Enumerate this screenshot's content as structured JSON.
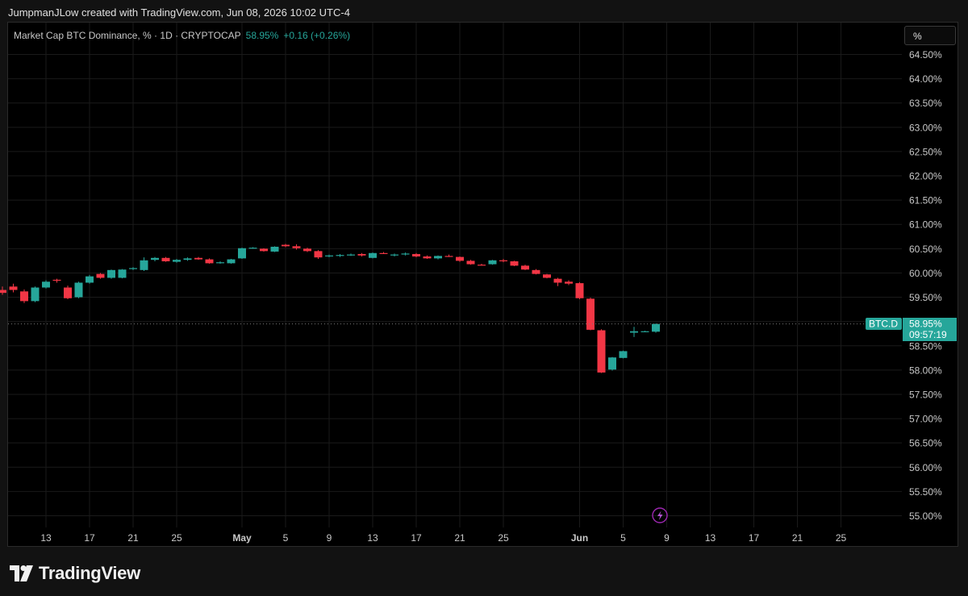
{
  "header": {
    "attribution": "JumpmanJLow created with TradingView.com, Jun 08, 2026 10:02 UTC-4"
  },
  "legend": {
    "symbol": "Market Cap BTC Dominance, % · 1D · CRYPTOCAP",
    "value": "58.95%",
    "change": "+0.16 (+0.26%)"
  },
  "scale_button": {
    "label": "%"
  },
  "price_tag": {
    "symbol": "BTC.D",
    "value": "58.95%",
    "countdown": "09:57:19"
  },
  "footer": {
    "brand": "TradingView"
  },
  "colors": {
    "up": "#26a69a",
    "down": "#f23645",
    "background": "#000000",
    "grid": "#1a1a1a",
    "axis_text": "#c8c8c8"
  },
  "icons": {
    "alert": "lightning-icon",
    "logo": "tradingview-logo-icon"
  },
  "chart_data": {
    "type": "candlestick",
    "title": "Market Cap BTC Dominance, % · 1D · CRYPTOCAP",
    "ylim": [
      54.85,
      64.75
    ],
    "y_ticks": [
      "64.50%",
      "64.00%",
      "63.50%",
      "63.00%",
      "62.50%",
      "62.00%",
      "61.50%",
      "61.00%",
      "60.50%",
      "60.00%",
      "59.50%",
      "59.00%",
      "58.50%",
      "58.00%",
      "57.50%",
      "57.00%",
      "56.50%",
      "56.00%",
      "55.50%",
      "55.00%"
    ],
    "y_tick_values": [
      64.5,
      64.0,
      63.5,
      63.0,
      62.5,
      62.0,
      61.5,
      61.0,
      60.5,
      60.0,
      59.5,
      59.0,
      58.5,
      58.0,
      57.5,
      57.0,
      56.5,
      56.0,
      55.5,
      55.0
    ],
    "x_ticks": [
      {
        "label": "13",
        "date": "2026-04-13",
        "bold": false
      },
      {
        "label": "17",
        "date": "2026-04-17",
        "bold": false
      },
      {
        "label": "21",
        "date": "2026-04-21",
        "bold": false
      },
      {
        "label": "25",
        "date": "2026-04-25",
        "bold": false
      },
      {
        "label": "May",
        "date": "2026-05-01",
        "bold": true
      },
      {
        "label": "5",
        "date": "2026-05-05",
        "bold": false
      },
      {
        "label": "9",
        "date": "2026-05-09",
        "bold": false
      },
      {
        "label": "13",
        "date": "2026-05-13",
        "bold": false
      },
      {
        "label": "17",
        "date": "2026-05-17",
        "bold": false
      },
      {
        "label": "21",
        "date": "2026-05-21",
        "bold": false
      },
      {
        "label": "25",
        "date": "2026-05-25",
        "bold": false
      },
      {
        "label": "Jun",
        "date": "2026-06-01",
        "bold": true
      },
      {
        "label": "5",
        "date": "2026-06-05",
        "bold": false
      },
      {
        "label": "9",
        "date": "2026-06-09",
        "bold": false
      },
      {
        "label": "13",
        "date": "2026-06-13",
        "bold": false
      },
      {
        "label": "17",
        "date": "2026-06-17",
        "bold": false
      },
      {
        "label": "21",
        "date": "2026-06-21",
        "bold": false
      },
      {
        "label": "25",
        "date": "2026-06-25",
        "bold": false
      }
    ],
    "last_value": 58.95,
    "candles": [
      {
        "date": "2026-04-09",
        "open": 59.65,
        "high": 59.72,
        "low": 59.55,
        "close": 59.59
      },
      {
        "date": "2026-04-10",
        "open": 59.72,
        "high": 59.78,
        "low": 59.6,
        "close": 59.65
      },
      {
        "date": "2026-04-11",
        "open": 59.62,
        "high": 59.66,
        "low": 59.38,
        "close": 59.42
      },
      {
        "date": "2026-04-12",
        "open": 59.42,
        "high": 59.72,
        "low": 59.4,
        "close": 59.7
      },
      {
        "date": "2026-04-13",
        "open": 59.7,
        "high": 59.85,
        "low": 59.68,
        "close": 59.82
      },
      {
        "date": "2026-04-14",
        "open": 59.86,
        "high": 59.88,
        "low": 59.8,
        "close": 59.84
      },
      {
        "date": "2026-04-15",
        "open": 59.7,
        "high": 59.74,
        "low": 59.46,
        "close": 59.48
      },
      {
        "date": "2026-04-16",
        "open": 59.5,
        "high": 59.82,
        "low": 59.48,
        "close": 59.8
      },
      {
        "date": "2026-04-17",
        "open": 59.8,
        "high": 59.96,
        "low": 59.78,
        "close": 59.93
      },
      {
        "date": "2026-04-18",
        "open": 59.98,
        "high": 60.0,
        "low": 59.88,
        "close": 59.9
      },
      {
        "date": "2026-04-19",
        "open": 59.9,
        "high": 60.07,
        "low": 59.88,
        "close": 60.06
      },
      {
        "date": "2026-04-20",
        "open": 59.9,
        "high": 60.08,
        "low": 59.89,
        "close": 60.07
      },
      {
        "date": "2026-04-21",
        "open": 60.08,
        "high": 60.12,
        "low": 60.06,
        "close": 60.1
      },
      {
        "date": "2026-04-22",
        "open": 60.06,
        "high": 60.32,
        "low": 60.04,
        "close": 60.26
      },
      {
        "date": "2026-04-23",
        "open": 60.27,
        "high": 60.33,
        "low": 60.24,
        "close": 60.31
      },
      {
        "date": "2026-04-24",
        "open": 60.31,
        "high": 60.33,
        "low": 60.23,
        "close": 60.24
      },
      {
        "date": "2026-04-25",
        "open": 60.23,
        "high": 60.29,
        "low": 60.21,
        "close": 60.27
      },
      {
        "date": "2026-04-26",
        "open": 60.27,
        "high": 60.32,
        "low": 60.25,
        "close": 60.3
      },
      {
        "date": "2026-04-27",
        "open": 60.31,
        "high": 60.33,
        "low": 60.27,
        "close": 60.28
      },
      {
        "date": "2026-04-28",
        "open": 60.28,
        "high": 60.3,
        "low": 60.19,
        "close": 60.2
      },
      {
        "date": "2026-04-29",
        "open": 60.21,
        "high": 60.24,
        "low": 60.19,
        "close": 60.22
      },
      {
        "date": "2026-04-30",
        "open": 60.2,
        "high": 60.29,
        "low": 60.19,
        "close": 60.28
      },
      {
        "date": "2026-05-01",
        "open": 60.3,
        "high": 60.52,
        "low": 60.29,
        "close": 60.51
      },
      {
        "date": "2026-05-02",
        "open": 60.51,
        "high": 60.53,
        "low": 60.5,
        "close": 60.52
      },
      {
        "date": "2026-05-03",
        "open": 60.5,
        "high": 60.51,
        "low": 60.44,
        "close": 60.45
      },
      {
        "date": "2026-05-04",
        "open": 60.44,
        "high": 60.55,
        "low": 60.43,
        "close": 60.54
      },
      {
        "date": "2026-05-05",
        "open": 60.58,
        "high": 60.6,
        "low": 60.53,
        "close": 60.55
      },
      {
        "date": "2026-05-06",
        "open": 60.55,
        "high": 60.59,
        "low": 60.48,
        "close": 60.51
      },
      {
        "date": "2026-05-07",
        "open": 60.5,
        "high": 60.52,
        "low": 60.43,
        "close": 60.45
      },
      {
        "date": "2026-05-08",
        "open": 60.45,
        "high": 60.47,
        "low": 60.29,
        "close": 60.32
      },
      {
        "date": "2026-05-09",
        "open": 60.34,
        "high": 60.38,
        "low": 60.32,
        "close": 60.36
      },
      {
        "date": "2026-05-10",
        "open": 60.35,
        "high": 60.39,
        "low": 60.33,
        "close": 60.37
      },
      {
        "date": "2026-05-11",
        "open": 60.37,
        "high": 60.4,
        "low": 60.35,
        "close": 60.38
      },
      {
        "date": "2026-05-12",
        "open": 60.39,
        "high": 60.41,
        "low": 60.34,
        "close": 60.36
      },
      {
        "date": "2026-05-13",
        "open": 60.31,
        "high": 60.42,
        "low": 60.3,
        "close": 60.41
      },
      {
        "date": "2026-05-14",
        "open": 60.41,
        "high": 60.43,
        "low": 60.39,
        "close": 60.4
      },
      {
        "date": "2026-05-15",
        "open": 60.36,
        "high": 60.4,
        "low": 60.34,
        "close": 60.38
      },
      {
        "date": "2026-05-16",
        "open": 60.38,
        "high": 60.42,
        "low": 60.36,
        "close": 60.4
      },
      {
        "date": "2026-05-17",
        "open": 60.39,
        "high": 60.41,
        "low": 60.32,
        "close": 60.34
      },
      {
        "date": "2026-05-18",
        "open": 60.34,
        "high": 60.36,
        "low": 60.29,
        "close": 60.3
      },
      {
        "date": "2026-05-19",
        "open": 60.3,
        "high": 60.36,
        "low": 60.28,
        "close": 60.35
      },
      {
        "date": "2026-05-20",
        "open": 60.35,
        "high": 60.38,
        "low": 60.33,
        "close": 60.34
      },
      {
        "date": "2026-05-21",
        "open": 60.33,
        "high": 60.34,
        "low": 60.23,
        "close": 60.25
      },
      {
        "date": "2026-05-22",
        "open": 60.25,
        "high": 60.27,
        "low": 60.17,
        "close": 60.18
      },
      {
        "date": "2026-05-23",
        "open": 60.17,
        "high": 60.19,
        "low": 60.15,
        "close": 60.16
      },
      {
        "date": "2026-05-24",
        "open": 60.18,
        "high": 60.27,
        "low": 60.17,
        "close": 60.26
      },
      {
        "date": "2026-05-25",
        "open": 60.26,
        "high": 60.29,
        "low": 60.22,
        "close": 60.24
      },
      {
        "date": "2026-05-26",
        "open": 60.24,
        "high": 60.25,
        "low": 60.14,
        "close": 60.15
      },
      {
        "date": "2026-05-27",
        "open": 60.15,
        "high": 60.17,
        "low": 60.06,
        "close": 60.07
      },
      {
        "date": "2026-05-28",
        "open": 60.06,
        "high": 60.08,
        "low": 59.97,
        "close": 59.98
      },
      {
        "date": "2026-05-29",
        "open": 59.97,
        "high": 59.98,
        "low": 59.89,
        "close": 59.9
      },
      {
        "date": "2026-05-30",
        "open": 59.88,
        "high": 59.9,
        "low": 59.73,
        "close": 59.8
      },
      {
        "date": "2026-05-31",
        "open": 59.82,
        "high": 59.85,
        "low": 59.75,
        "close": 59.78
      },
      {
        "date": "2026-06-01",
        "open": 59.79,
        "high": 59.81,
        "low": 59.46,
        "close": 59.48
      },
      {
        "date": "2026-06-02",
        "open": 59.47,
        "high": 59.49,
        "low": 58.82,
        "close": 58.83
      },
      {
        "date": "2026-06-03",
        "open": 58.82,
        "high": 58.84,
        "low": 57.94,
        "close": 57.95
      },
      {
        "date": "2026-06-04",
        "open": 58.01,
        "high": 58.27,
        "low": 57.99,
        "close": 58.26
      },
      {
        "date": "2026-06-05",
        "open": 58.25,
        "high": 58.4,
        "low": 58.24,
        "close": 58.39
      },
      {
        "date": "2026-06-06",
        "open": 58.77,
        "high": 58.89,
        "low": 58.68,
        "close": 58.8
      },
      {
        "date": "2026-06-07",
        "open": 58.79,
        "high": 58.81,
        "low": 58.78,
        "close": 58.8
      },
      {
        "date": "2026-06-08",
        "open": 58.79,
        "high": 58.96,
        "low": 58.77,
        "close": 58.95
      }
    ]
  }
}
